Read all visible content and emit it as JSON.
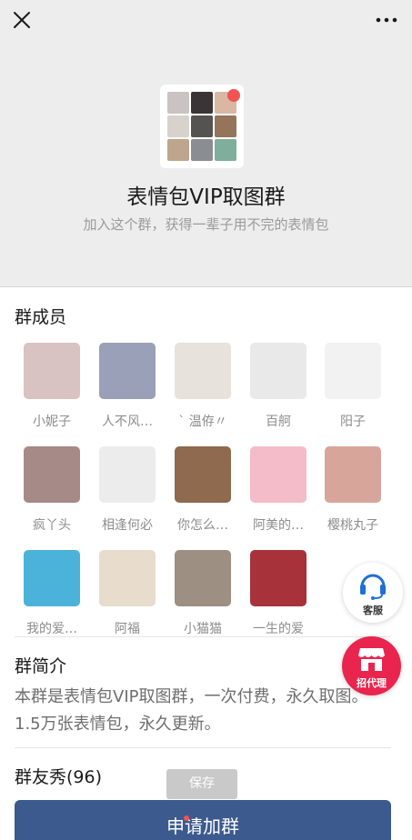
{
  "topbar": {
    "close_icon": "close-icon",
    "more_icon": "more-dots-icon"
  },
  "group": {
    "title": "表情包VIP取图群",
    "subtitle": "加入这个群，获得一辈子用不完的表情包",
    "avatar_colors": [
      "#c9c3c3",
      "#3b3436",
      "#d9b7a3",
      "#d7d2cb",
      "#555352",
      "#94755a",
      "#bca78d",
      "#8a8d92",
      "#7fae9c"
    ]
  },
  "members_section": {
    "title": "群成员",
    "members": [
      {
        "name": "小妮子",
        "color": "#d8c2c2"
      },
      {
        "name": "人不风…",
        "color": "#9aa0b8"
      },
      {
        "name": "` 温侟〃",
        "color": "#e8e2dc"
      },
      {
        "name": "百舸",
        "color": "#e9e9e9"
      },
      {
        "name": "阳子",
        "color": "#f2f2f2"
      },
      {
        "name": "疯丫头",
        "color": "#a68a88"
      },
      {
        "name": "相逢何必",
        "color": "#ececec"
      },
      {
        "name": "你怎么…",
        "color": "#8f6a4e"
      },
      {
        "name": "阿美的…",
        "color": "#f3bcc8"
      },
      {
        "name": "樱桃丸子",
        "color": "#d7a59a"
      },
      {
        "name": "我的爱…",
        "color": "#4bb3da"
      },
      {
        "name": "阿福",
        "color": "#e8dccd"
      },
      {
        "name": "小猫猫",
        "color": "#9d8f82"
      },
      {
        "name": "一生的爱",
        "color": "#a8323a"
      }
    ]
  },
  "intro_section": {
    "title": "群简介",
    "text": "本群是表情包VIP取图群，一次付费，永久取图。1.5万张表情包，永久更新。"
  },
  "show_section": {
    "title": "群友秀(96)"
  },
  "floating": {
    "service_label": "客服",
    "service_icon": "headset-icon",
    "agent_label": "招代理",
    "agent_icon": "shop-icon"
  },
  "actions": {
    "save_label": "保存",
    "join_label": "申请加群"
  }
}
